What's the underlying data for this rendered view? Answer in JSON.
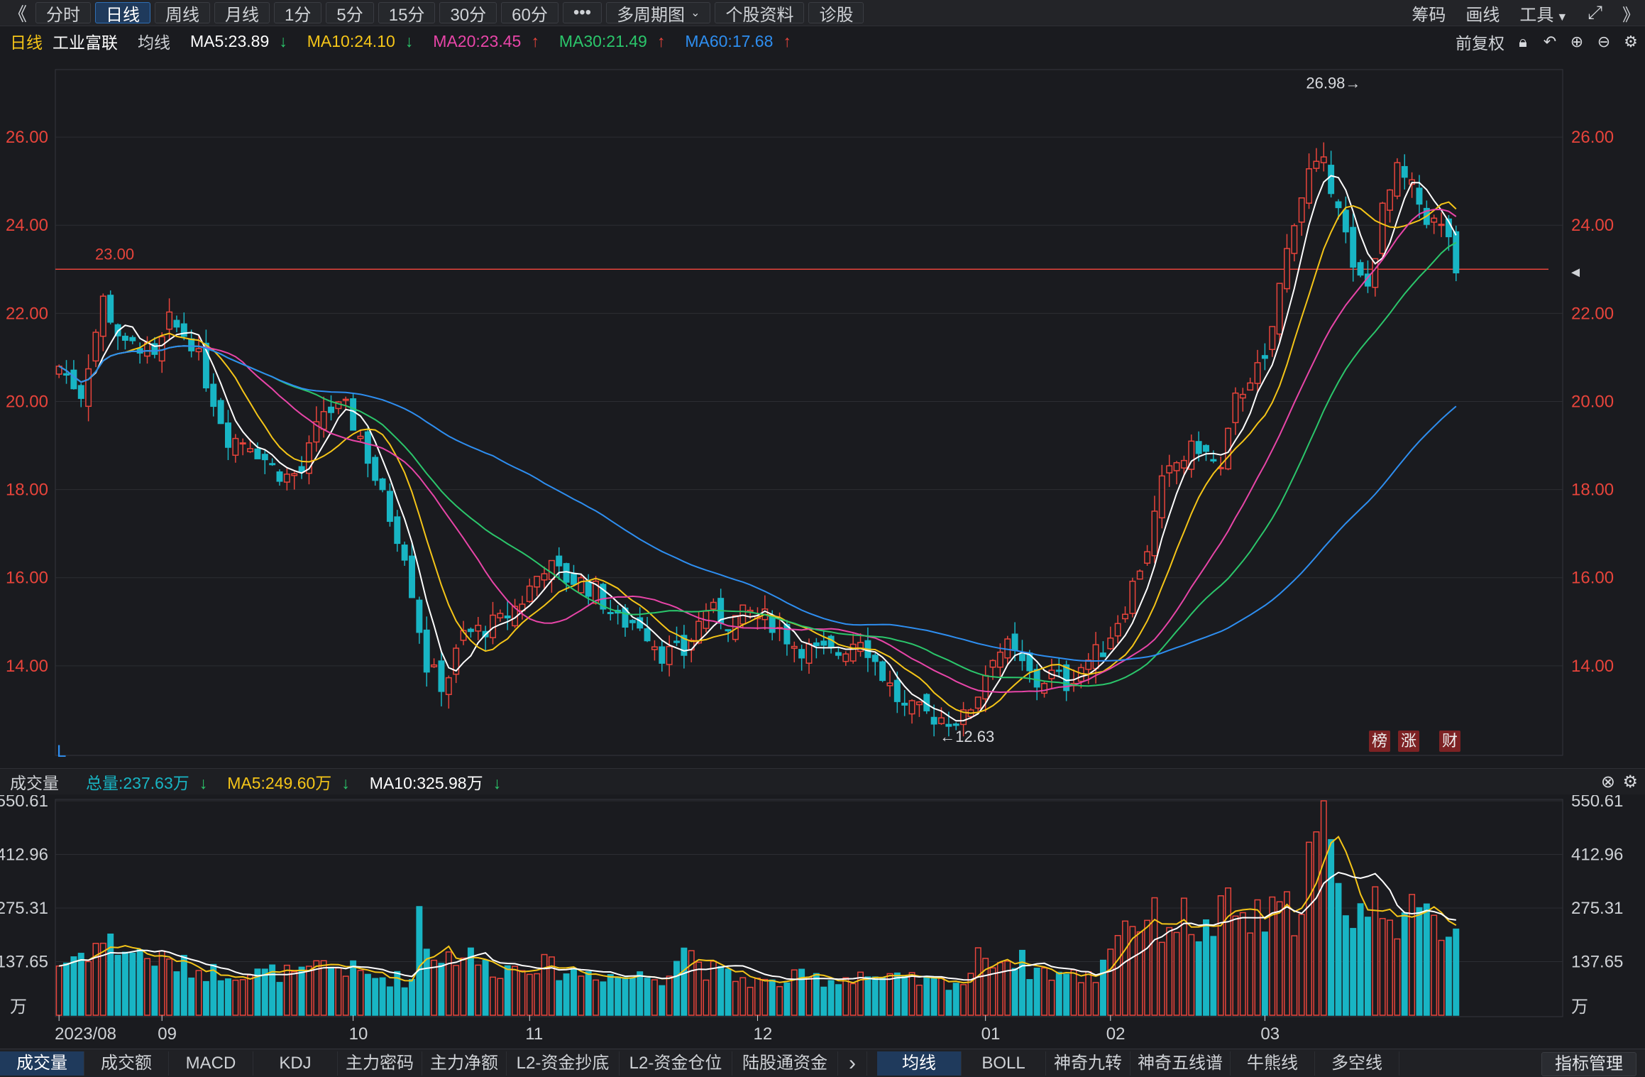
{
  "toolbar": {
    "back": "《",
    "forward": "》",
    "periods": [
      "分时",
      "日线",
      "周线",
      "月线",
      "1分",
      "5分",
      "15分",
      "30分",
      "60分"
    ],
    "active_period": "日线",
    "more": "•••",
    "multi_period": "多周期图",
    "info": "个股资料",
    "diag": "诊股",
    "right": [
      "筹码",
      "画线",
      "工具"
    ]
  },
  "legend": {
    "period": "日线",
    "name": "工业富联",
    "ma_label": "均线",
    "ma5": "MA5:23.89",
    "ma10": "MA10:24.10",
    "ma20": "MA20:23.45",
    "ma30": "MA30:21.49",
    "ma60": "MA60:17.68",
    "adjust": "前复权"
  },
  "colors": {
    "up": "#e8443b",
    "down": "#18b5c4",
    "ma5": "#ffffff",
    "ma10": "#f5c518",
    "ma20": "#e845a8",
    "ma30": "#2bc66b",
    "ma60": "#2e8ef0",
    "axis_text": "#e8443b"
  },
  "volume_header": {
    "label": "成交量",
    "total": "总量:237.63万",
    "ma5": "MA5:249.60万",
    "ma10": "MA10:325.98万"
  },
  "tags": [
    "榜",
    "涨",
    "财"
  ],
  "bottom_tabs_left": [
    "成交量",
    "成交额",
    "MACD",
    "KDJ",
    "主力密码",
    "主力净额",
    "L2-资金抄底",
    "L2-资金仓位",
    "陆股通资金"
  ],
  "bottom_tabs_right": [
    "均线",
    "BOLL",
    "神奇九转",
    "神奇五线谱",
    "牛熊线",
    "多空线"
  ],
  "bottom_more": "›",
  "indicator_mgmt": "指标管理",
  "chart_data": {
    "type": "candlestick",
    "price_axis": {
      "ticks": [
        "26.00",
        "24.00",
        "22.00",
        "20.00",
        "18.00",
        "16.00",
        "14.00"
      ],
      "ylim": [
        12.0,
        27.5
      ]
    },
    "volume_axis": {
      "ticks": [
        "550.61",
        "412.96",
        "275.31",
        "137.65"
      ],
      "unit": "万",
      "ylim": [
        0,
        550.61
      ]
    },
    "x_labels": [
      "2023/08",
      "09",
      "10",
      "11",
      "12",
      "01",
      "02",
      "03"
    ],
    "x_label_index": [
      0,
      14,
      40,
      64,
      95,
      126,
      143,
      164
    ],
    "hline": {
      "value": 23.0,
      "label": "23.00"
    },
    "max_label": "26.98→",
    "min_label": "←12.63",
    "corner_label": "L",
    "n": 205,
    "series_keys": [
      "open",
      "high",
      "low",
      "close",
      "volume",
      "ma5",
      "ma10",
      "ma20",
      "ma30",
      "ma60",
      "vol_ma5",
      "vol_ma10"
    ],
    "anchors": {
      "close": [
        [
          0,
          20.8
        ],
        [
          3,
          20.2
        ],
        [
          6,
          22.3
        ],
        [
          9,
          21.2
        ],
        [
          11,
          21.3
        ],
        [
          13,
          20.9
        ],
        [
          15,
          21.8
        ],
        [
          18,
          21.4
        ],
        [
          20,
          20.5
        ],
        [
          23,
          19.2
        ],
        [
          26,
          19.1
        ],
        [
          29,
          18.5
        ],
        [
          31,
          18.3
        ],
        [
          33,
          18.4
        ],
        [
          36,
          19.8
        ],
        [
          39,
          19.8
        ],
        [
          41,
          19.2
        ],
        [
          44,
          17.8
        ],
        [
          47,
          16.6
        ],
        [
          50,
          14.0
        ],
        [
          52,
          13.6
        ],
        [
          53,
          13.8
        ],
        [
          55,
          14.7
        ],
        [
          57,
          14.8
        ],
        [
          60,
          15.0
        ],
        [
          63,
          15.5
        ],
        [
          66,
          16.3
        ],
        [
          69,
          16.0
        ],
        [
          71,
          15.9
        ],
        [
          73,
          15.7
        ],
        [
          76,
          15.0
        ],
        [
          79,
          15.0
        ],
        [
          82,
          14.3
        ],
        [
          85,
          14.3
        ],
        [
          88,
          15.3
        ],
        [
          91,
          15.0
        ],
        [
          94,
          15.2
        ],
        [
          97,
          15.0
        ],
        [
          100,
          14.5
        ],
        [
          103,
          14.3
        ],
        [
          106,
          14.3
        ],
        [
          109,
          14.7
        ],
        [
          112,
          13.8
        ],
        [
          115,
          13.0
        ],
        [
          118,
          12.9
        ],
        [
          121,
          12.8
        ],
        [
          123,
          12.8
        ],
        [
          125,
          13.4
        ],
        [
          127,
          14.3
        ],
        [
          129,
          14.4
        ],
        [
          131,
          14.0
        ],
        [
          133,
          13.6
        ],
        [
          135,
          13.8
        ],
        [
          137,
          13.6
        ],
        [
          139,
          14.0
        ],
        [
          142,
          14.4
        ],
        [
          145,
          15.4
        ],
        [
          148,
          16.7
        ],
        [
          150,
          18.1
        ],
        [
          152,
          18.6
        ],
        [
          155,
          19.0
        ],
        [
          158,
          18.4
        ],
        [
          160,
          20.0
        ],
        [
          162,
          20.6
        ],
        [
          164,
          20.8
        ],
        [
          166,
          22.6
        ],
        [
          168,
          24.2
        ],
        [
          170,
          25.2
        ],
        [
          172,
          25.3
        ],
        [
          174,
          24.6
        ],
        [
          176,
          22.9
        ],
        [
          178,
          22.6
        ],
        [
          180,
          24.3
        ],
        [
          182,
          25.2
        ],
        [
          184,
          24.8
        ],
        [
          186,
          24.2
        ],
        [
          188,
          23.9
        ],
        [
          189,
          23.8
        ],
        [
          190,
          22.7
        ]
      ],
      "volume": [
        [
          0,
          130
        ],
        [
          3,
          160
        ],
        [
          6,
          190
        ],
        [
          9,
          170
        ],
        [
          12,
          150
        ],
        [
          15,
          135
        ],
        [
          18,
          120
        ],
        [
          21,
          110
        ],
        [
          24,
          115
        ],
        [
          27,
          105
        ],
        [
          30,
          110
        ],
        [
          33,
          100
        ],
        [
          36,
          130
        ],
        [
          39,
          120
        ],
        [
          42,
          100
        ],
        [
          45,
          95
        ],
        [
          48,
          90
        ],
        [
          49,
          280
        ],
        [
          50,
          180
        ],
        [
          52,
          150
        ],
        [
          55,
          160
        ],
        [
          58,
          125
        ],
        [
          61,
          120
        ],
        [
          64,
          140
        ],
        [
          67,
          120
        ],
        [
          70,
          110
        ],
        [
          73,
          110
        ],
        [
          76,
          100
        ],
        [
          79,
          100
        ],
        [
          82,
          100
        ],
        [
          85,
          180
        ],
        [
          88,
          120
        ],
        [
          91,
          100
        ],
        [
          94,
          90
        ],
        [
          97,
          80
        ],
        [
          100,
          95
        ],
        [
          103,
          95
        ],
        [
          106,
          90
        ],
        [
          109,
          110
        ],
        [
          112,
          90
        ],
        [
          115,
          90
        ],
        [
          118,
          85
        ],
        [
          121,
          85
        ],
        [
          123,
          85
        ],
        [
          126,
          170
        ],
        [
          128,
          140
        ],
        [
          130,
          150
        ],
        [
          132,
          120
        ],
        [
          135,
          110
        ],
        [
          138,
          100
        ],
        [
          141,
          100
        ],
        [
          144,
          230
        ],
        [
          147,
          250
        ],
        [
          150,
          240
        ],
        [
          153,
          250
        ],
        [
          156,
          210
        ],
        [
          159,
          270
        ],
        [
          162,
          240
        ],
        [
          165,
          250
        ],
        [
          168,
          270
        ],
        [
          170,
          400
        ],
        [
          172,
          500
        ],
        [
          174,
          300
        ],
        [
          176,
          280
        ],
        [
          178,
          270
        ],
        [
          180,
          300
        ],
        [
          182,
          260
        ],
        [
          184,
          250
        ],
        [
          186,
          240
        ],
        [
          188,
          235
        ],
        [
          190,
          237
        ]
      ]
    }
  }
}
